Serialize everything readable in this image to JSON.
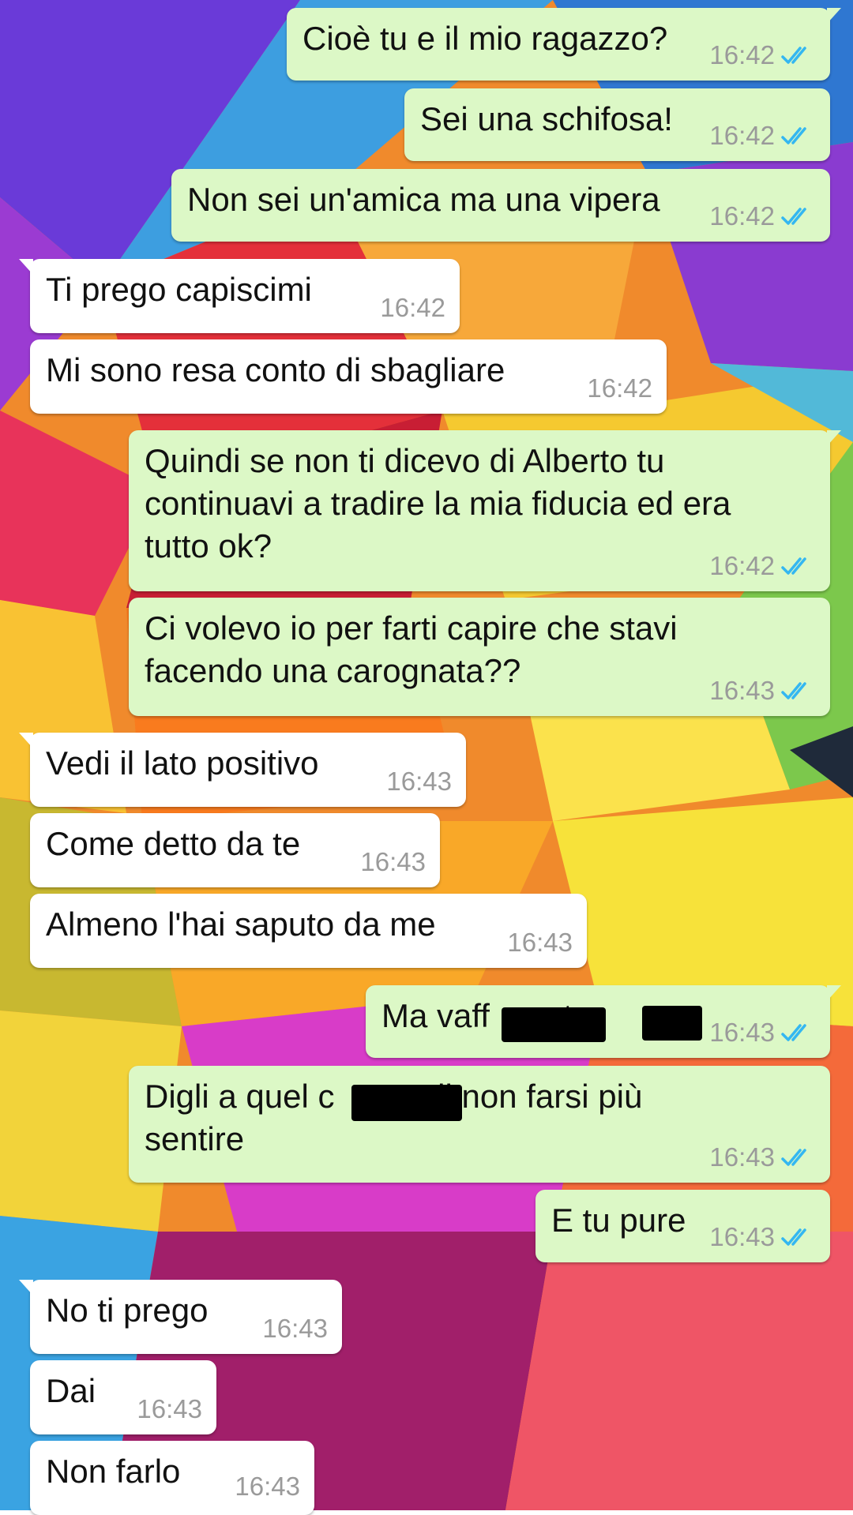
{
  "conversation": {
    "colors": {
      "outgoing_bubble": "#dcf8c6",
      "incoming_bubble": "#ffffff",
      "read_ticks": "#34b7f1",
      "timestamp": "#9a9a9a"
    },
    "read_icon": "double-check-read-icon",
    "messages": [
      {
        "direction": "outgoing",
        "text": "Cioè tu e il mio ragazzo?",
        "time": "16:42"
      },
      {
        "direction": "outgoing",
        "text": "Sei una schifosa!",
        "time": "16:42"
      },
      {
        "direction": "outgoing",
        "text": "Non sei un'amica ma una vipera",
        "time": "16:42"
      },
      {
        "direction": "incoming",
        "text": "Ti prego capiscimi",
        "time": "16:42"
      },
      {
        "direction": "incoming",
        "text": "Mi sono resa conto di sbagliare",
        "time": "16:42"
      },
      {
        "direction": "outgoing",
        "text": "Quindi se non ti dicevo di Alberto tu\ncontinuavi a tradire la mia fiducia ed era\ntutto ok?",
        "time": "16:42"
      },
      {
        "direction": "outgoing",
        "text": "Ci volevo io per farti capire che stavi\nfacendo una carognata??",
        "time": "16:43"
      },
      {
        "direction": "incoming",
        "text": "Vedi il lato positivo",
        "time": "16:43"
      },
      {
        "direction": "incoming",
        "text": "Come detto da te",
        "time": "16:43"
      },
      {
        "direction": "incoming",
        "text": "Almeno l'hai saputo da me",
        "time": "16:43"
      },
      {
        "direction": "outgoing",
        "text": "Ma vaff        tr",
        "time": "16:43",
        "redacted": true
      },
      {
        "direction": "outgoing",
        "text": "Digli a quel c          di non farsi più\nsentire",
        "time": "16:43",
        "redacted": true
      },
      {
        "direction": "outgoing",
        "text": "E tu pure",
        "time": "16:43"
      },
      {
        "direction": "incoming",
        "text": "No ti prego",
        "time": "16:43"
      },
      {
        "direction": "incoming",
        "text": "Dai",
        "time": "16:43"
      },
      {
        "direction": "incoming",
        "text": "Non farlo",
        "time": "16:43"
      }
    ]
  }
}
